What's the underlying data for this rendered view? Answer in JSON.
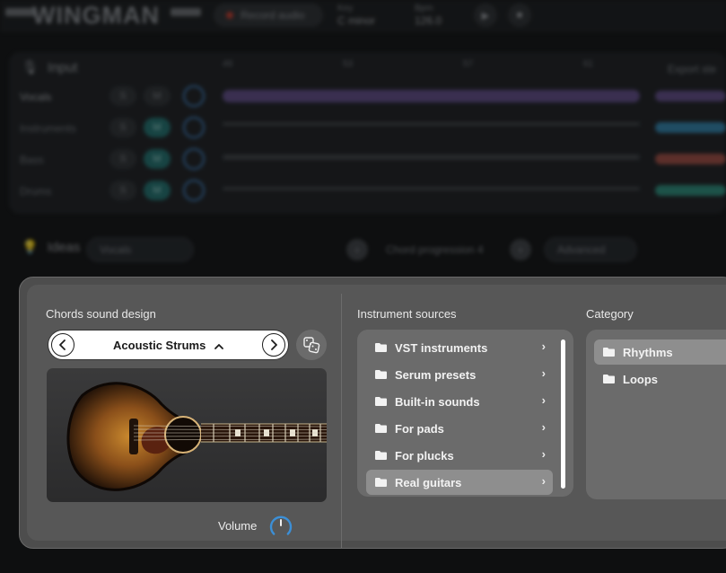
{
  "app": {
    "name": "WINGMAN",
    "record_label": "Record audio",
    "key_label": "Key",
    "key_value": "C minor",
    "bpm_label": "Bpm",
    "bpm_value": "126.0"
  },
  "input_panel": {
    "title": "Input",
    "ruler": [
      "49",
      "53",
      "57",
      "61"
    ],
    "export_label": "Export ste",
    "tracks": [
      {
        "name": "Vocals",
        "solo": "S",
        "mute": "M",
        "mute_on": false,
        "color": "#7a5fa8"
      },
      {
        "name": "Instruments",
        "solo": "S",
        "mute": "M",
        "mute_on": true,
        "color": "#2f8fbf"
      },
      {
        "name": "Bass",
        "solo": "S",
        "mute": "M",
        "mute_on": true,
        "color": "#b0574a"
      },
      {
        "name": "Drums",
        "solo": "S",
        "mute": "M",
        "mute_on": true,
        "color": "#2f9f8a"
      }
    ]
  },
  "ideas_bar": {
    "title": "Ideas",
    "source_select": "Vocals",
    "idea_name": "Chord progression 4",
    "advanced_label": "Advanced"
  },
  "modal": {
    "sound_design": {
      "title": "Chords sound design",
      "preset_name": "Acoustic Strums",
      "volume_label": "Volume",
      "volume_level": 0.5
    },
    "instrument_sources": {
      "title": "Instrument sources",
      "items": [
        {
          "label": "VST instruments",
          "selected": false
        },
        {
          "label": "Serum presets",
          "selected": false
        },
        {
          "label": "Built-in sounds",
          "selected": false
        },
        {
          "label": "For pads",
          "selected": false
        },
        {
          "label": "For plucks",
          "selected": false
        },
        {
          "label": "Real guitars",
          "selected": true
        }
      ]
    },
    "category": {
      "title": "Category",
      "items": [
        {
          "label": "Rhythms",
          "selected": true
        },
        {
          "label": "Loops",
          "selected": false
        }
      ]
    }
  },
  "colors": {
    "accent_teal": "#1f6f6d",
    "knob_blue": "#3c8fd6",
    "modal_bg": "#575757"
  }
}
